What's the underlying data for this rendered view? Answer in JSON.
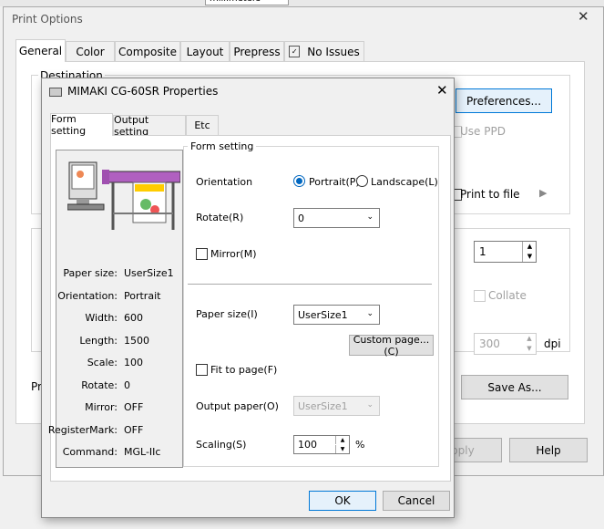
{
  "background": {
    "units": "millimeters"
  },
  "print_options": {
    "title": "Print Options",
    "tabs": [
      "General",
      "Color",
      "Composite",
      "Layout",
      "Prepress",
      "No Issues"
    ],
    "destination_label": "Destination",
    "preferences_label": "Preferences...",
    "use_ppd_label": "Use PPD",
    "print_to_file_label": "Print to file",
    "copies_value": "1",
    "collate_label": "Collate",
    "dpi_value": "300",
    "dpi_unit": "dpi",
    "pr_label": "Pr",
    "save_as_label": "Save As...",
    "apply_label": "pply",
    "help_label": "Help"
  },
  "props": {
    "title": "MIMAKI CG-60SR Properties",
    "tabs": [
      "Form setting",
      "Output setting",
      "Etc"
    ],
    "group_label": "Form setting",
    "orientation_label": "Orientation",
    "portrait_label": "Portrait(P)",
    "landscape_label": "Landscape(L)",
    "rotate_label": "Rotate(R)",
    "rotate_value": "0",
    "mirror_label": "Mirror(M)",
    "paper_size_label": "Paper size(I)",
    "paper_size_value": "UserSize1",
    "custom_page_label": "Custom page...(C)",
    "fit_label": "Fit to page(F)",
    "output_paper_label": "Output paper(O)",
    "output_paper_value": "UserSize1",
    "scaling_label": "Scaling(S)",
    "scaling_value": "100",
    "scaling_unit": "%",
    "ok_label": "OK",
    "cancel_label": "Cancel",
    "status": [
      {
        "k": "Paper size:",
        "v": "UserSize1"
      },
      {
        "k": "Orientation:",
        "v": "Portrait"
      },
      {
        "k": "Width:",
        "v": "600"
      },
      {
        "k": "Length:",
        "v": "1500"
      },
      {
        "k": "Scale:",
        "v": "100"
      },
      {
        "k": "Rotate:",
        "v": "0"
      },
      {
        "k": "Mirror:",
        "v": "OFF"
      },
      {
        "k": "RegisterMark:",
        "v": "OFF"
      },
      {
        "k": "Command:",
        "v": "MGL-IIc"
      }
    ]
  }
}
